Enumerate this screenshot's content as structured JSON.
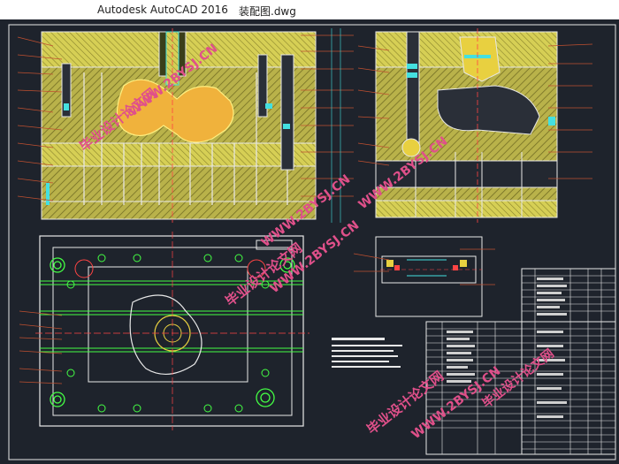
{
  "window": {
    "app_title": "Autodesk AutoCAD 2016",
    "file_name": "装配图.dwg"
  },
  "watermarks": [
    {
      "text": "毕业设计论文网",
      "variant": "cn"
    },
    {
      "text": "WWW.2BYSJ.CN",
      "variant": "url"
    },
    {
      "text": "毕业设计论文网",
      "variant": "cn"
    },
    {
      "text": "WWW.2BYSJ.CN",
      "variant": "url"
    },
    {
      "text": "WWW.2BYSJ.CN",
      "variant": "url"
    },
    {
      "text": "毕业设计论文网",
      "variant": "cn"
    },
    {
      "text": "WWW.2BYSJ.CN",
      "variant": "url"
    },
    {
      "text": "毕业设计论文网",
      "variant": "cn"
    },
    {
      "text": "WWW.2BYSJ.CN",
      "variant": "url"
    }
  ],
  "colors": {
    "background": "#1e232c",
    "hatch_yellow": "#c8c050",
    "line_green": "#44ff44",
    "line_red": "#ff4444",
    "cyan": "#44e0e0",
    "frame": "#e8e8e8",
    "watermark": "#e0508a"
  }
}
